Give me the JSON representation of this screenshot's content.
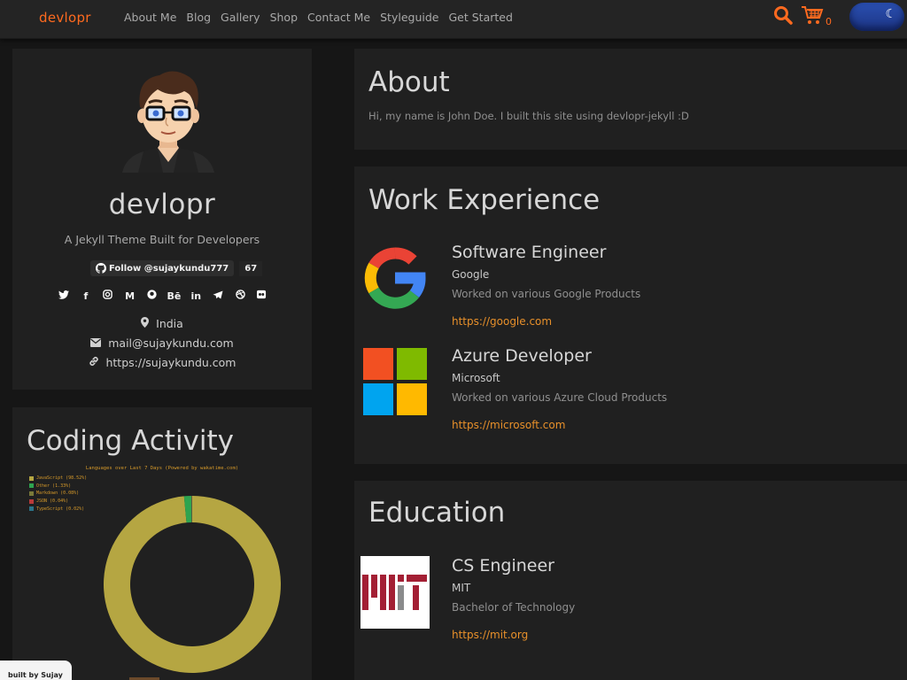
{
  "nav": {
    "brand": "devlopr",
    "links": [
      "About Me",
      "Blog",
      "Gallery",
      "Shop",
      "Contact Me",
      "Styleguide",
      "Get Started"
    ],
    "cart_count": "0",
    "icons": [
      "search-icon",
      "cart-icon",
      "moon-icon"
    ]
  },
  "profile": {
    "title": "devlopr",
    "tagline": "A Jekyll Theme Built for Developers",
    "github_label": "Follow @sujaykundu777",
    "github_count": "67",
    "social_icons": [
      "twitter-icon",
      "facebook-icon",
      "instagram-icon",
      "medium-icon",
      "github-icon",
      "behance-icon",
      "linkedin-icon",
      "telegram-icon",
      "dribbble-icon",
      "flickr-icon"
    ],
    "location": "India",
    "email": "mail@sujaykundu.com",
    "website": "https://sujaykundu.com"
  },
  "coding": {
    "heading": "Coding Activity",
    "chart_title": "Languages over Last 7 Days (Powered by wakatime.com)"
  },
  "chart_data": {
    "type": "pie",
    "title": "Languages over Last 7 Days (Powered by wakatime.com)",
    "categories": [
      "JavaScript",
      "Other",
      "Markdown",
      "JSON",
      "TypeScript"
    ],
    "values": [
      98.52,
      1.33,
      0.08,
      0.04,
      0.02
    ],
    "legend_labels": [
      "JavaScript (98.52%)",
      "Other (1.33%)",
      "Markdown (0.08%)",
      "JSON (0.04%)",
      "TypeScript (0.02%)"
    ],
    "colors": [
      "#b5a642",
      "#2ea44f",
      "#7a7a3a",
      "#b93a3a",
      "#2b7489"
    ],
    "legend": "top-left"
  },
  "about": {
    "heading": "About",
    "text": "Hi, my name is John Doe. I built this site using devlopr-jekyll :D"
  },
  "work": {
    "heading": "Work Experience",
    "items": [
      {
        "role": "Software Engineer",
        "org": "Google",
        "desc": "Worked on various Google Products",
        "link": "https://google.com"
      },
      {
        "role": "Azure Developer",
        "org": "Microsoft",
        "desc": "Worked on various Azure Cloud Products",
        "link": "https://microsoft.com"
      }
    ]
  },
  "education": {
    "heading": "Education",
    "items": [
      {
        "role": "CS Engineer",
        "org": "MIT",
        "desc": "Bachelor of Technology",
        "link": "https://mit.org"
      }
    ]
  },
  "footer": {
    "built_by": "built by Sujay"
  },
  "colors": {
    "accent": "#ff6a1f",
    "link": "#e8902a",
    "background": "#161616",
    "card": "#202020"
  }
}
